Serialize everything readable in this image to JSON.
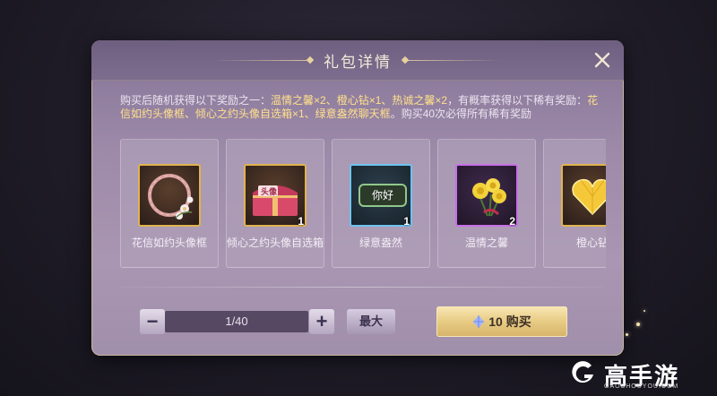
{
  "dialog": {
    "title": "礼包详情",
    "desc_parts": [
      {
        "text": "购买后随机获得以下奖励之一：",
        "hl": false
      },
      {
        "text": "温情之馨×2、橙心钻×1、热诚之馨×2",
        "hl": true
      },
      {
        "text": "，有概率获得以下稀有奖励：",
        "hl": false
      },
      {
        "text": "花信如约头像框、倾心之约头像自选箱×1、绿意盎然聊天框",
        "hl": true
      },
      {
        "text": "。购买40次必得所有稀有奖励",
        "hl": false
      }
    ],
    "items": [
      {
        "name": "花信如约头像框",
        "qty": "",
        "icon": "wreath-frame-icon",
        "rarity": "gold"
      },
      {
        "name": "倾心之约头像自选箱",
        "qty": "1",
        "icon": "gift-chest-icon",
        "rarity": "gold",
        "chest_label": "头像"
      },
      {
        "name": "绿意盎然",
        "qty": "1",
        "icon": "chat-bubble-icon",
        "rarity": "blue",
        "bubble_text": "你好"
      },
      {
        "name": "温情之馨",
        "qty": "2",
        "icon": "yellow-roses-icon",
        "rarity": "purple"
      },
      {
        "name": "橙心钻",
        "qty": "",
        "icon": "heart-gem-icon",
        "rarity": "gold"
      }
    ],
    "stepper": {
      "minus": "−",
      "plus": "+",
      "value": "1/40"
    },
    "max_label": "最大",
    "buy": {
      "price": "10",
      "label": "购买"
    }
  },
  "watermark": {
    "text": "高手游",
    "sub": "GAOSHOUYOU.COM"
  },
  "colors": {
    "highlight": "#ffe08a",
    "gold_frame": "#e0b34f",
    "blue_frame": "#6ec2f0",
    "purple_frame": "#c86ee8"
  }
}
